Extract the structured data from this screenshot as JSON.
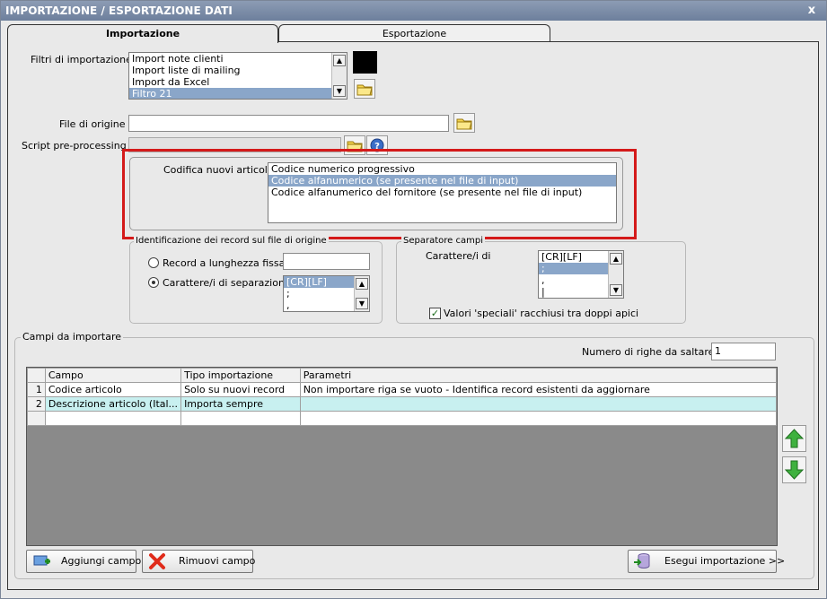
{
  "window": {
    "title": "IMPORTAZIONE / ESPORTAZIONE DATI",
    "close_glyph": "x"
  },
  "tabs": [
    {
      "label": "Importazione",
      "active": true
    },
    {
      "label": "Esportazione",
      "active": false
    }
  ],
  "filters": {
    "label": "Filtri di importazione :",
    "items": [
      "Import note clienti",
      "Import liste di mailing",
      "Import da Excel",
      "Filtro 21"
    ],
    "selected": "Filtro 21"
  },
  "file_origine": {
    "label": "File di origine :",
    "value": ""
  },
  "script_pre": {
    "label": "Script pre-processing :",
    "value": ""
  },
  "codifica": {
    "label": "Codifica nuovi articoli :",
    "options": [
      "Codice numerico progressivo",
      "Codice alfanumerico (se presente nel file di input)",
      "Codice alfanumerico del fornitore (se presente nel file di input)"
    ],
    "selected": "Codice alfanumerico (se presente nel file di input)"
  },
  "identificazione": {
    "title": "Identificazione dei record sul file di origine",
    "record_fixed": "Record a lunghezza fissa",
    "record_sep": "Carattere/i di separazione",
    "selected": "Carattere/i di separazione",
    "sep_items": [
      "[CR][LF]",
      ";",
      ","
    ]
  },
  "separatore": {
    "title": "Separatore campi",
    "label": "Carattere/i di",
    "items": [
      "[CR][LF]",
      ";",
      ",",
      "|"
    ],
    "checkbox_label": "Valori 'speciali' racchiusi tra doppi apici",
    "checked": true
  },
  "campi": {
    "title": "Campi da importare",
    "skip_label": "Numero di righe da saltare :",
    "skip_value": "1",
    "columns": [
      "Campo",
      "Tipo importazione",
      "Parametri"
    ],
    "rows": [
      {
        "n": "1",
        "campo": "Codice articolo",
        "tipo": "Solo su nuovi record",
        "parametri": "Non importare riga se vuoto - Identifica record esistenti da aggiornare"
      },
      {
        "n": "2",
        "campo": "Descrizione articolo (Ital...",
        "tipo": "Importa sempre",
        "parametri": ""
      }
    ]
  },
  "buttons": {
    "add": "Aggiungi campo",
    "remove": "Rimuovi campo",
    "run": "Esegui importazione >>"
  },
  "colors": {
    "highlight": "#d41a1a",
    "selection": "#8aa6c9",
    "title_bar": "#7a8aa6"
  }
}
